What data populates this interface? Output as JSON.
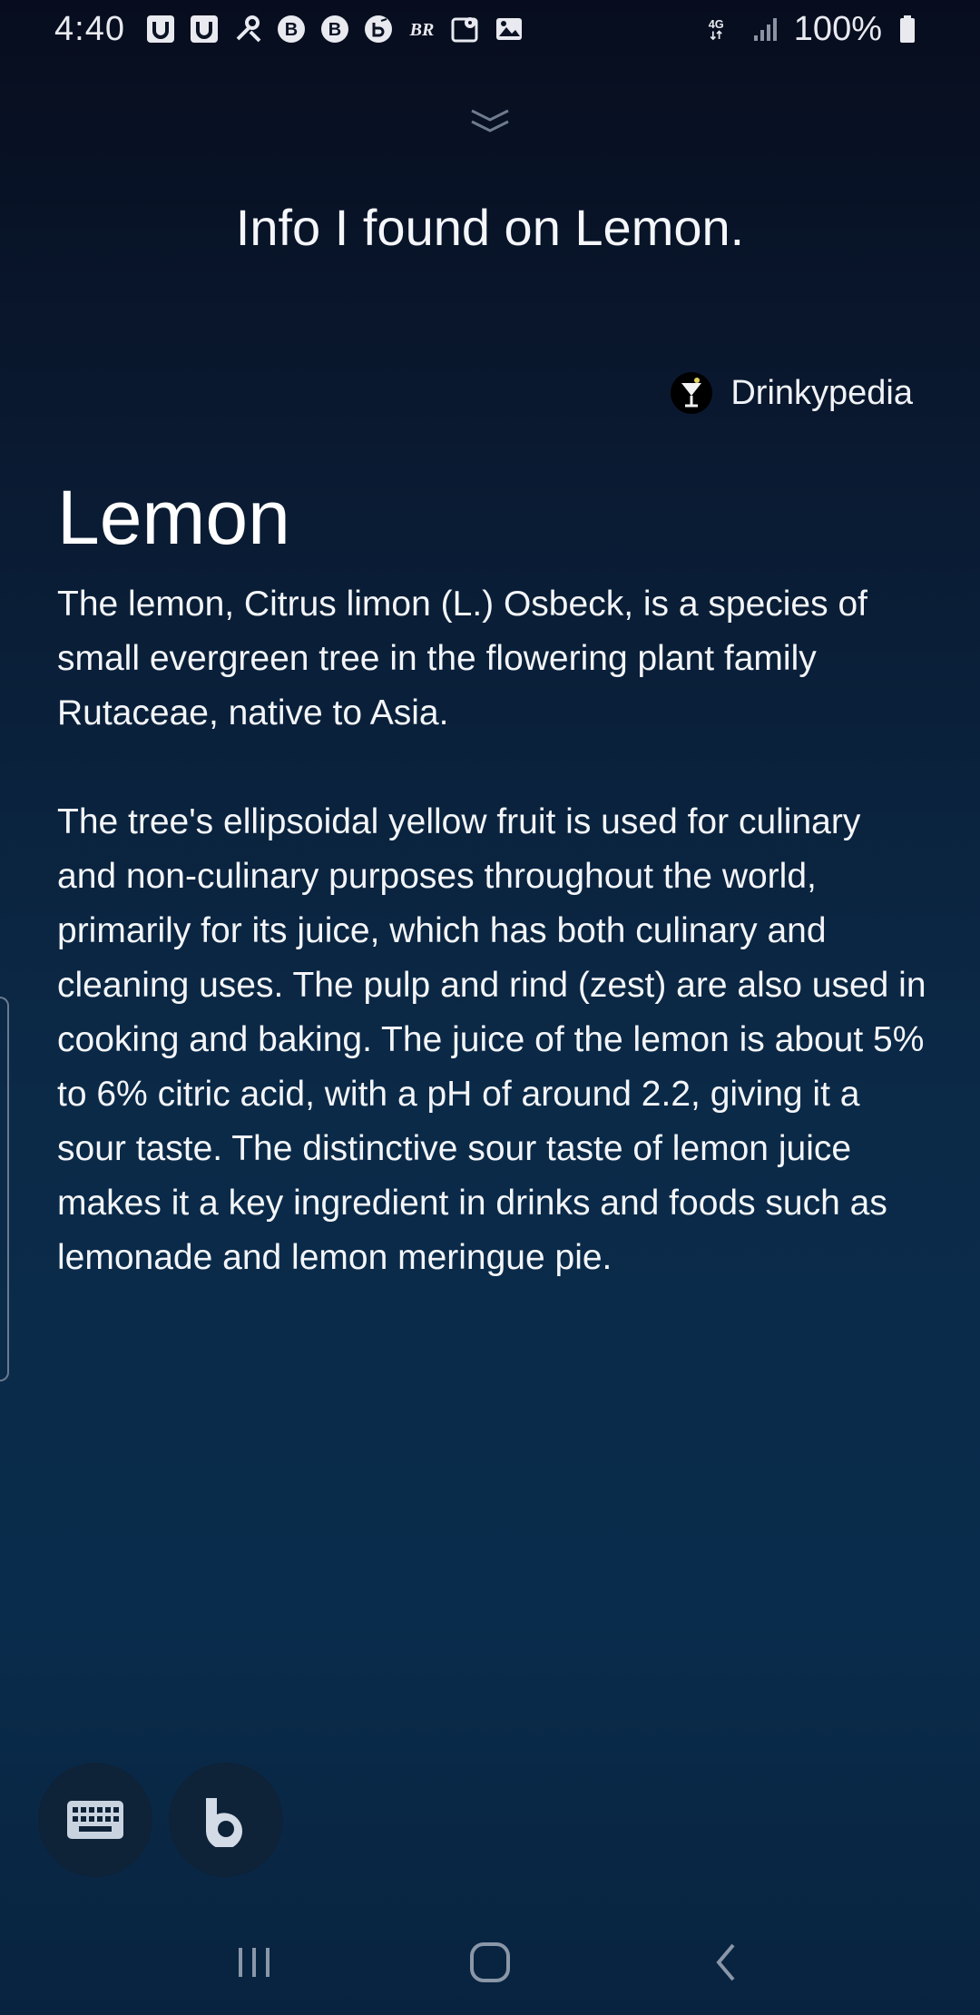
{
  "status_bar": {
    "time": "4:40",
    "battery_percent": "100%",
    "notification_icons": [
      "u-icon",
      "u-icon",
      "tools-icon",
      "b-icon",
      "b-icon",
      "clock-b-icon",
      "br-icon",
      "map-pin-icon",
      "image-icon"
    ],
    "network": "4G"
  },
  "header": {
    "title": "Info I found on Lemon."
  },
  "source": {
    "name": "Drinkypedia",
    "icon": "cocktail-glass-icon"
  },
  "article": {
    "title": "Lemon",
    "paragraphs": [
      "The lemon, Citrus limon (L.) Osbeck, is a species of small evergreen tree in the flowering plant family Rutaceae, native to Asia.",
      "The tree's ellipsoidal yellow fruit is used for culinary and non-culinary purposes throughout the world, primarily for its juice, which has both culinary and cleaning uses. The pulp and rind (zest) are also used in cooking and baking. The juice of the lemon is about 5% to 6% citric acid, with a pH of around 2.2, giving it a sour taste. The distinctive sour taste of lemon juice makes it a key ingredient in drinks and foods such as lemonade and lemon meringue pie."
    ]
  },
  "bottom_buttons": {
    "keyboard": "keyboard-icon",
    "bixby": "bixby-icon"
  },
  "nav": {
    "recents": "recents-icon",
    "home": "home-icon",
    "back": "back-icon"
  },
  "colors": {
    "background_top": "#070d1e",
    "background_bottom": "#0a2c4c",
    "button_bg": "#0e2238",
    "text": "#ffffff"
  }
}
